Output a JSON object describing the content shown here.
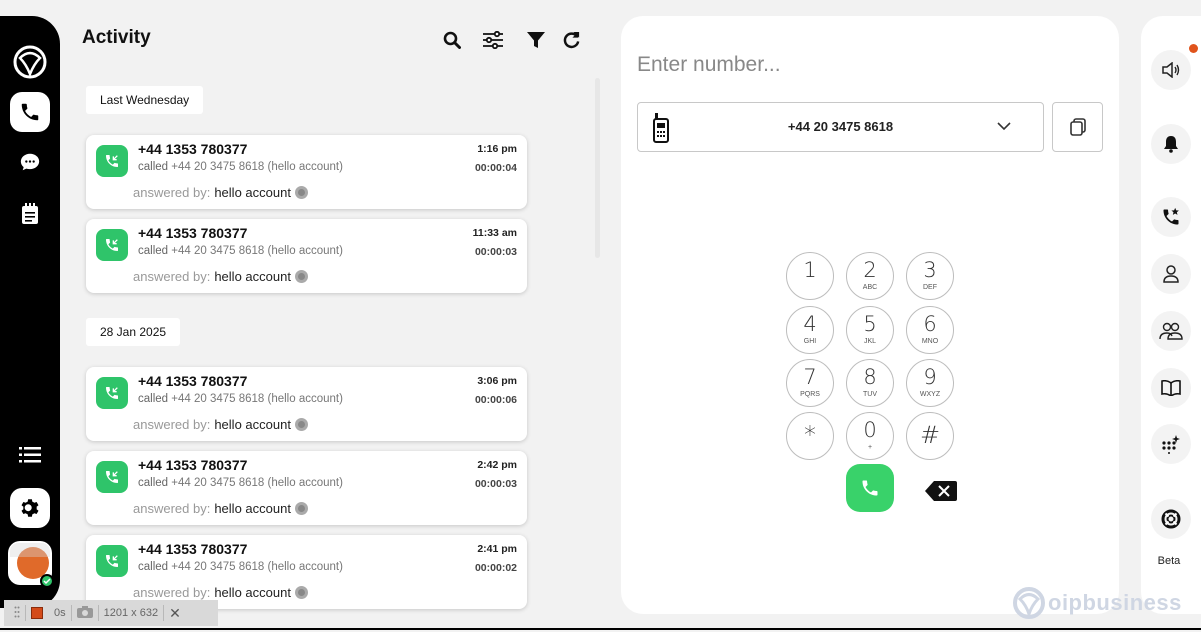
{
  "activity": {
    "title": "Activity",
    "groups": [
      {
        "date": "Last Wednesday",
        "calls": [
          {
            "number": "+44 1353 780377",
            "called_prefix": "called",
            "called_to": "+44 20 3475 8618 (hello account)",
            "answered_label": "answered by:",
            "answered_by": "hello account",
            "time": "1:16 pm",
            "duration": "00:00:04"
          },
          {
            "number": "+44 1353 780377",
            "called_prefix": "called",
            "called_to": "+44 20 3475 8618 (hello account)",
            "answered_label": "answered by:",
            "answered_by": "hello account",
            "time": "11:33 am",
            "duration": "00:00:03"
          }
        ]
      },
      {
        "date": "28 Jan 2025",
        "calls": [
          {
            "number": "+44 1353 780377",
            "called_prefix": "called",
            "called_to": "+44 20 3475 8618 (hello account)",
            "answered_label": "answered by:",
            "answered_by": "hello account",
            "time": "3:06 pm",
            "duration": "00:00:06"
          },
          {
            "number": "+44 1353 780377",
            "called_prefix": "called",
            "called_to": "+44 20 3475 8618 (hello account)",
            "answered_label": "answered by:",
            "answered_by": "hello account",
            "time": "2:42 pm",
            "duration": "00:00:03"
          },
          {
            "number": "+44 1353 780377",
            "called_prefix": "called",
            "called_to": "+44 20 3475 8618 (hello account)",
            "answered_label": "answered by:",
            "answered_by": "hello account",
            "time": "2:41 pm",
            "duration": "00:00:02"
          }
        ]
      }
    ]
  },
  "dialer": {
    "placeholder": "Enter number...",
    "caller_id": "+44 20 3475 8618",
    "keys": [
      {
        "digit": "1",
        "letters": ""
      },
      {
        "digit": "2",
        "letters": "ABC"
      },
      {
        "digit": "3",
        "letters": "DEF"
      },
      {
        "digit": "4",
        "letters": "GHI"
      },
      {
        "digit": "5",
        "letters": "JKL"
      },
      {
        "digit": "6",
        "letters": "MNO"
      },
      {
        "digit": "7",
        "letters": "PQRS"
      },
      {
        "digit": "8",
        "letters": "TUV"
      },
      {
        "digit": "9",
        "letters": "WXYZ"
      },
      {
        "digit": "*",
        "letters": ""
      },
      {
        "digit": "0",
        "letters": "+"
      },
      {
        "digit": "#",
        "letters": ""
      }
    ]
  },
  "right_rail": {
    "beta": "Beta"
  },
  "watermark": "oipbusiness",
  "recorder": {
    "elapsed": "0s",
    "dimensions": "1201 x 632"
  },
  "colors": {
    "accent_green": "#2fc46a",
    "call_button": "#39d26a",
    "notification": "#e0541c"
  }
}
